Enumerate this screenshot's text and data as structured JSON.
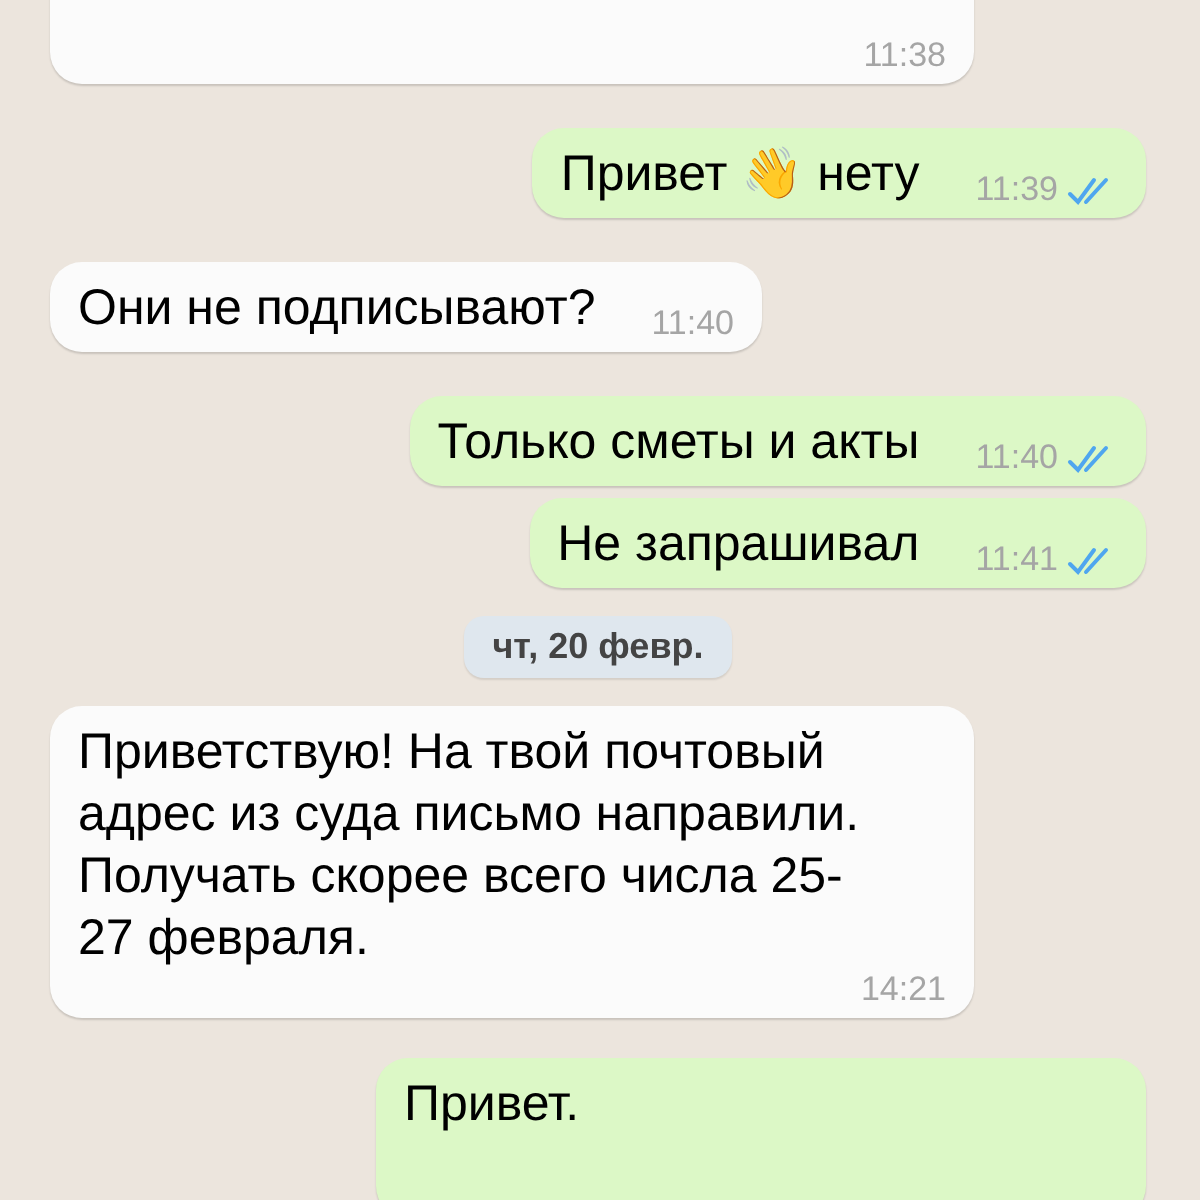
{
  "messages": [
    {
      "kind": "incoming",
      "time": "11:38"
    },
    {
      "kind": "outgoing",
      "text": "Привет 👋 нету",
      "time": "11:39",
      "read": true
    },
    {
      "kind": "incoming",
      "text": "Они не подписывают?",
      "time": "11:40"
    },
    {
      "kind": "outgoing",
      "text": "Только сметы и акты",
      "time": "11:40",
      "read": true
    },
    {
      "kind": "outgoing",
      "text": "Не запрашивал",
      "time": "11:41",
      "read": true
    },
    {
      "kind": "date",
      "text": "чт, 20 февр."
    },
    {
      "kind": "incoming",
      "text": "Приветствую! На твой почтовый адрес из суда письмо направили. Получать скорее всего числа 25-27 февраля.",
      "time": "14:21"
    },
    {
      "kind": "outgoing",
      "text": "Привет."
    }
  ]
}
